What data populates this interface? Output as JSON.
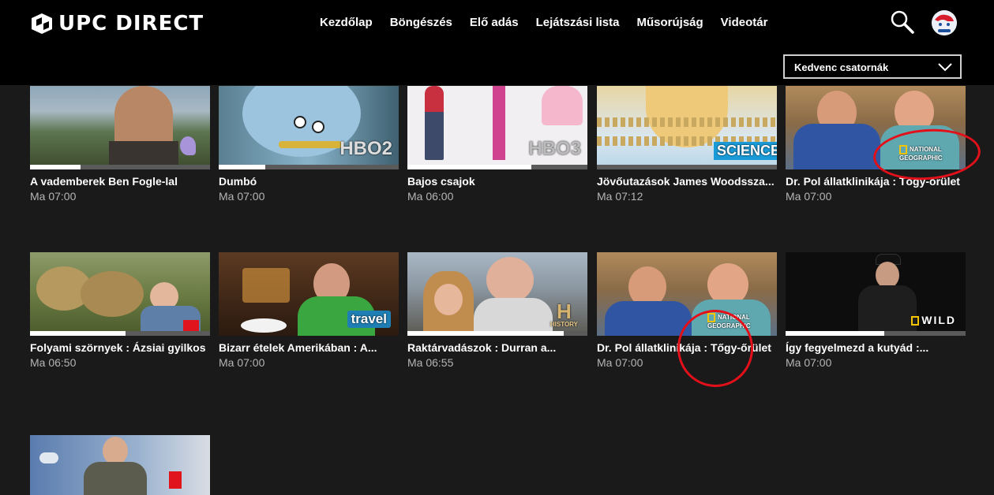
{
  "header": {
    "logo_text": "UPC DIRECT",
    "nav": [
      "Kezdőlap",
      "Böngészés",
      "Elő adás",
      "Lejátszási lista",
      "Műsorújság",
      "Videotár"
    ],
    "dropdown_value": "Kedvenc csatornák"
  },
  "cards": [
    {
      "title": "A vademberek Ben Fogle-lal",
      "time": "Ma 07:00",
      "progress": 0.28,
      "channel": ""
    },
    {
      "title": "Dumbó",
      "time": "Ma 07:00",
      "progress": 0.26,
      "channel": "HBO2"
    },
    {
      "title": "Bajos csajok",
      "time": "Ma 06:00",
      "progress": 0.69,
      "channel": "HBO3"
    },
    {
      "title": "Jövőutazások James Woodssza...",
      "time": "Ma 07:12",
      "progress": 0.0,
      "channel": "SCIENCE"
    },
    {
      "title": "Dr. Pol állatklinikája : Tőgy-őrület",
      "time": "Ma 07:00",
      "progress": 0.0,
      "channel": "NATIONAL GEOGRAPHIC"
    },
    {
      "title": "Folyami szörnyek : Ázsiai gyilkos",
      "time": "Ma 06:50",
      "progress": 0.53,
      "channel": ""
    },
    {
      "title": "Bizarr ételek Amerikában : A...",
      "time": "Ma 07:00",
      "progress": 0.0,
      "channel": "travel"
    },
    {
      "title": "Raktárvadászok : Durran a...",
      "time": "Ma 06:55",
      "progress": 0.87,
      "channel": "HISTORY"
    },
    {
      "title": "Dr. Pol állatklinikája : Tőgy-őrület",
      "time": "Ma 07:00",
      "progress": 0.0,
      "channel": "NATIONAL GEOGRAPHIC"
    },
    {
      "title": "Így fegyelmezd a kutyád :...",
      "time": "Ma 07:00",
      "progress": 0.55,
      "channel": "WILD"
    },
    {
      "title": "",
      "time": "",
      "progress": 0.0,
      "channel": ""
    }
  ],
  "colors": {
    "header_bg": "#000000",
    "page_bg": "#1a1a1a",
    "annotation": "#e3101a"
  }
}
